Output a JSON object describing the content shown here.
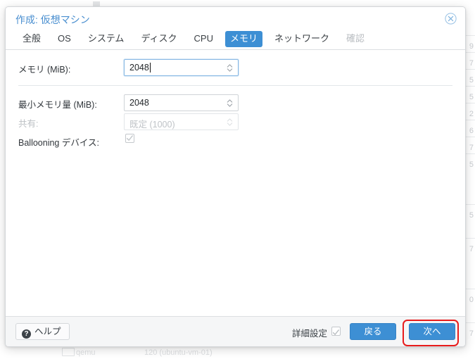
{
  "dialog": {
    "title": "作成: 仮想マシン",
    "close_icon": "close-circle-icon",
    "tabs": [
      {
        "label": "全般",
        "state": "normal"
      },
      {
        "label": "OS",
        "state": "normal"
      },
      {
        "label": "システム",
        "state": "normal"
      },
      {
        "label": "ディスク",
        "state": "normal"
      },
      {
        "label": "CPU",
        "state": "normal"
      },
      {
        "label": "メモリ",
        "state": "selected"
      },
      {
        "label": "ネットワーク",
        "state": "normal"
      },
      {
        "label": "確認",
        "state": "disabled"
      }
    ],
    "fields": [
      {
        "label": "メモリ (MiB):",
        "value": "2048",
        "state": "focused"
      },
      {
        "label": "最小メモリ量 (MiB):",
        "value": "2048",
        "state": "normal"
      },
      {
        "label": "共有:",
        "value": "既定 (1000)",
        "state": "disabled"
      },
      {
        "label": "Ballooning デバイス:",
        "value": "checked",
        "state": "disabled"
      }
    ],
    "footer": {
      "help_label": "ヘルプ",
      "help_icon": "question-mark-icon",
      "advanced_label": "詳細設定",
      "advanced_checked": true,
      "back_label": "戻る",
      "next_label": "次へ"
    }
  },
  "colors": {
    "accent": "#3d8fd4",
    "title": "#4a8fd0",
    "highlight_ring": "#e81c1c",
    "disabled_text": "#bfc3c7"
  },
  "background": {
    "edge_numbers": [
      "9",
      "7",
      "5",
      "5",
      "2",
      "6",
      "7",
      "5",
      "5",
      "7",
      "0",
      "7"
    ],
    "bottom_row": {
      "type": "qemu",
      "name": "120 (ubuntu-vm-01)"
    }
  }
}
